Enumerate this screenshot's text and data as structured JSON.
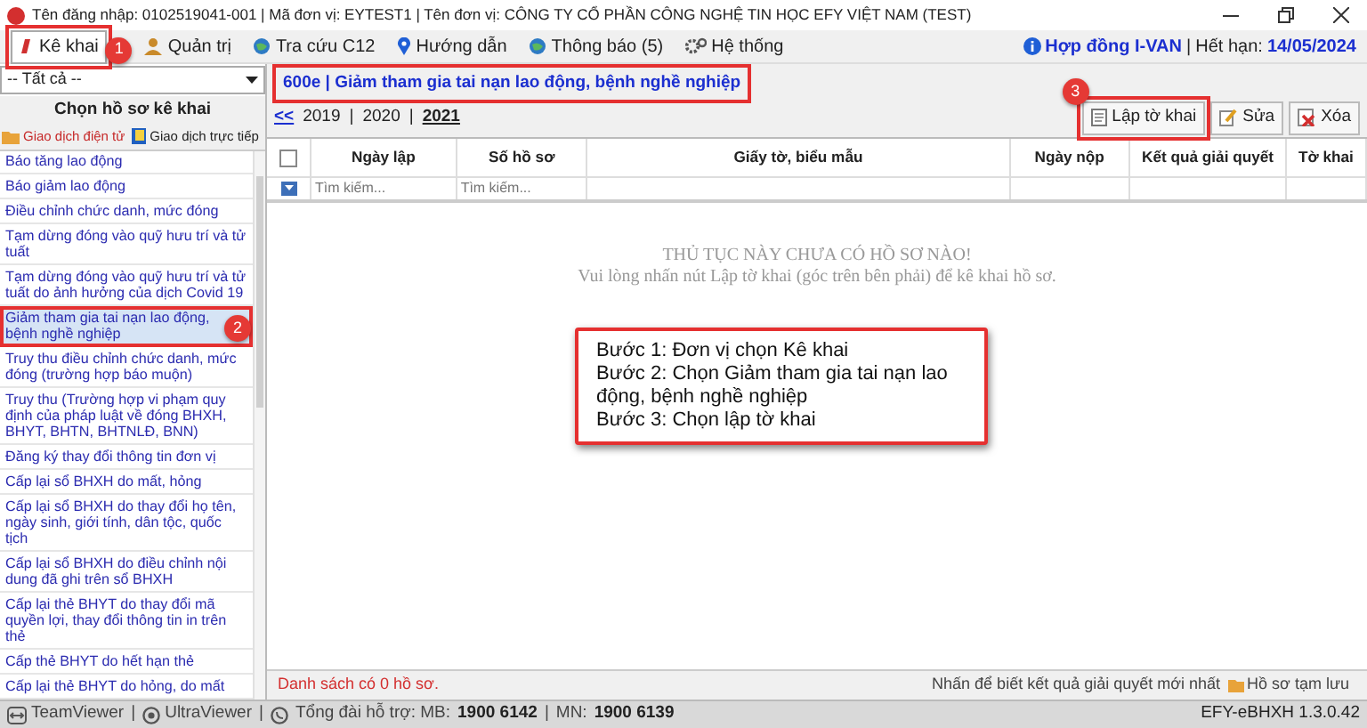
{
  "window": {
    "title": "Tên đăng nhập: 0102519041-001 | Mã đơn vị: EYTEST1 | Tên đơn vị: CÔNG TY CỔ PHẦN CÔNG NGHỆ TIN HỌC EFY VIỆT NAM (TEST)"
  },
  "menu": [
    {
      "label": "Kê khai",
      "selected": true,
      "callout": "1"
    },
    {
      "label": "Quản trị",
      "selected": false
    },
    {
      "label": "Tra cứu C12",
      "selected": false
    },
    {
      "label": "Hướng dẫn",
      "selected": false
    },
    {
      "label": "Thông báo (5)",
      "selected": false
    },
    {
      "label": "Hệ thống",
      "selected": false
    }
  ],
  "contract": {
    "label": "Hợp đồng I-VAN",
    "separator": "|",
    "expiry_label": "Hết hạn:",
    "expiry": "14/05/2024"
  },
  "sidebar": {
    "filter": "-- Tất cả --",
    "heading": "Chọn hồ sơ kê khai",
    "tabs": [
      {
        "label": "Giao dịch điện tử",
        "selected": true
      },
      {
        "label": "Giao dịch trực tiếp",
        "selected": false
      }
    ],
    "items": [
      {
        "label": "Báo tăng lao động",
        "selected": false
      },
      {
        "label": "Báo giảm lao động",
        "selected": false
      },
      {
        "label": "Điều chỉnh chức danh, mức đóng",
        "selected": false
      },
      {
        "label": "Tạm dừng đóng vào quỹ hưu trí và tử tuất",
        "selected": false
      },
      {
        "label": "Tạm dừng đóng vào quỹ hưu trí và tử tuất do ảnh hưởng của dịch Covid 19",
        "selected": false
      },
      {
        "label": "Giảm tham gia tai nạn lao động, bệnh nghề nghiệp",
        "selected": true,
        "callout": "2"
      },
      {
        "label": "Truy thu điều chỉnh chức danh, mức đóng (trường hợp báo muộn)",
        "selected": false
      },
      {
        "label": "Truy thu (Trường hợp vi phạm quy định của pháp luật về đóng BHXH, BHYT, BHTN, BHTNLĐ, BNN)",
        "selected": false
      },
      {
        "label": "Đăng ký thay đổi thông tin đơn vị",
        "selected": false
      },
      {
        "label": "Cấp lại sổ BHXH do mất, hỏng",
        "selected": false
      },
      {
        "label": "Cấp lại sổ BHXH do thay đổi họ tên, ngày sinh, giới tính, dân tộc, quốc tịch",
        "selected": false
      },
      {
        "label": "Cấp lại sổ BHXH do điều chỉnh nội dung đã ghi trên sổ BHXH",
        "selected": false
      },
      {
        "label": "Cấp lại thẻ BHYT do thay đổi mã quyền lợi, thay đổi thông tin in trên thẻ",
        "selected": false
      },
      {
        "label": "Cấp thẻ BHYT do hết hạn thẻ",
        "selected": false
      },
      {
        "label": "Cấp lại thẻ BHYT do hỏng, do mất",
        "selected": false
      }
    ]
  },
  "main": {
    "procedure": "600e | Giảm tham gia tai nạn lao động, bệnh nghề nghiệp",
    "year_nav": "<<",
    "year_separator": "|",
    "years": [
      {
        "label": "2019",
        "selected": false
      },
      {
        "label": "2020",
        "selected": false
      },
      {
        "label": "2021",
        "selected": true
      }
    ],
    "toolbar": [
      {
        "label": "Lập tờ khai",
        "callout": "3"
      },
      {
        "label": "Sửa"
      },
      {
        "label": "Xóa"
      }
    ],
    "table": {
      "select_all": {
        "checked": false
      },
      "columns": [
        "Ngày lập",
        "Số hồ sơ",
        "Giấy tờ, biểu mẫu",
        "Ngày nộp",
        "Kết quả giải quyết",
        "Tờ khai"
      ],
      "search_placeholders": [
        "Tìm kiếm...",
        "Tìm kiếm..."
      ],
      "empty_title": "THỦ TỤC NÀY CHƯA CÓ HỒ SƠ NÀO!",
      "empty_hint": "Vui lòng nhấn nút Lập tờ khai (góc trên bên phải) để kê khai hồ sơ."
    },
    "note": [
      "Bước 1: Đơn vị chọn Kê khai",
      "Bước 2: Chọn Giảm tham gia tai nạn lao động, bệnh nghề nghiệp",
      "Bước 3: Chọn lập tờ khai"
    ],
    "count": "Danh sách có 0 hồ sơ.",
    "result_hint": "Nhấn để biết kết quả giải quyết mới nhất",
    "temp_button": "Hồ sơ tạm lưu"
  },
  "status_bar": {
    "items": [
      {
        "label": "TeamViewer"
      },
      {
        "label": "UltraViewer"
      }
    ],
    "separator": "|",
    "hotline_label": "Tổng đài hỗ trợ: MB:",
    "hotline_mb": "1900 6142",
    "mn_separator": "|",
    "mn_label": "MN:",
    "hotline_mn": "1900 6139",
    "version": "EFY-eBHXH 1.3.0.42"
  }
}
